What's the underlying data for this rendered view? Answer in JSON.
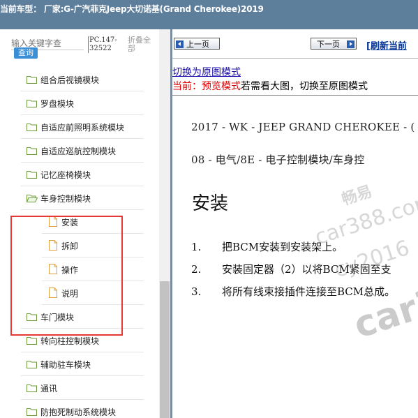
{
  "header": {
    "title": "当前车型： 厂家:G-广汽菲克Jeep大切诺基(Grand Cherokee)2019"
  },
  "sidebar": {
    "search": {
      "placeholder": "输入关键字查",
      "button_label": "查询"
    },
    "pc_code": "PC.147-32522",
    "collapse_all": "折叠全部",
    "items": [
      {
        "label": "组合后视镜模块",
        "type": "folder"
      },
      {
        "label": "罗盘模块",
        "type": "folder"
      },
      {
        "label": "自适应前照明系统模块",
        "type": "folder"
      },
      {
        "label": "自适应巡航控制模块",
        "type": "folder"
      },
      {
        "label": "记忆座椅模块",
        "type": "folder"
      },
      {
        "label": "车身控制模块",
        "type": "folder-open"
      },
      {
        "label": "安装",
        "type": "doc"
      },
      {
        "label": "拆卸",
        "type": "doc"
      },
      {
        "label": "操作",
        "type": "doc"
      },
      {
        "label": "说明",
        "type": "doc"
      },
      {
        "label": "车门模块",
        "type": "folder"
      },
      {
        "label": "转向柱控制模块",
        "type": "folder"
      },
      {
        "label": "辅助驻车模块",
        "type": "folder"
      },
      {
        "label": "通讯",
        "type": "folder"
      },
      {
        "label": "防抱死制动系统模块",
        "type": "folder"
      }
    ]
  },
  "content": {
    "nav": {
      "prev_label": "上一页",
      "next_label": "下一页",
      "refresh_label": "[刷新当前"
    },
    "mode_link": "切换为原图模式",
    "current_prefix": "当前：预览模式",
    "current_suffix": "若需看大图，切换至原图模式",
    "doc": {
      "line1": "2017 - WK - JEEP GRAND CHEROKEE - (",
      "line2": "08 - 电气/8E - 电子控制模块/车身控",
      "heading": "安装",
      "steps": [
        {
          "num": "1.",
          "text": "把BCM安装到安装架上。"
        },
        {
          "num": "2.",
          "text": "安装固定器（2）以将BCM紧固至支"
        },
        {
          "num": "3.",
          "text": "将所有线束接插件连接至BCM总成。"
        }
      ]
    }
  },
  "watermark": {
    "line1": "畅易",
    "line2": "car388.com",
    "line3": "cy2016",
    "line4": "car38"
  },
  "colors": {
    "header_bg": "#5e7f9c",
    "highlight": "#e53935",
    "status_red": "#e00000",
    "link": "#1a0dab"
  }
}
